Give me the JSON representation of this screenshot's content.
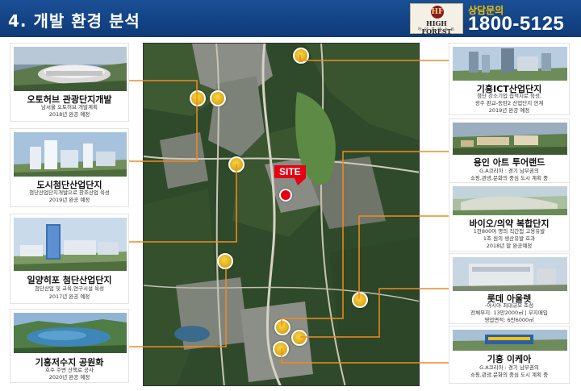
{
  "header": {
    "title": "4. 개발 환경 분석",
    "phone_label": "상담문의",
    "phone_number": "1800-5125",
    "logo_emblem": "HF",
    "logo_name": "HIGH FOREST",
    "logo_sub": "하 이 포 레 스 트"
  },
  "map": {
    "site_label": "SITE"
  },
  "left_cards": [
    {
      "title": "오토허브 관광단지개발",
      "desc": [
        "남서울 오토허브 개발계획",
        "2018년 완공 예정"
      ]
    },
    {
      "title": "도시첨단산업단지",
      "desc": [
        "첨단산업단지개발으로 창조산업 육성",
        "2019년 완공 예정"
      ]
    },
    {
      "title": "일양히포 첨단산업단지",
      "desc": [
        "첨단산업 및 교육,연구시설 육성",
        "2017년 완공 예정"
      ]
    },
    {
      "title": "기흥저수지 공원화",
      "desc": [
        "호수 주변 산책로 공사",
        "2020년 완공 예정"
      ]
    }
  ],
  "right_cards": [
    {
      "title": "기흥ICT산업단지",
      "desc": [
        "첨단 강소기업 집적지로 육성,",
        "광주 판교-동탄2 산업단지 연계",
        "2019년 완공 예정"
      ]
    },
    {
      "title": "용인 아트 투어랜드",
      "desc": [
        "G.A코리아 : 경기 남부권의",
        "쇼핑,관광,문화의 중심 도시 계획 중"
      ]
    },
    {
      "title": "바이오/의약 복합단지",
      "desc": [
        "1천800여 명의 직간접 고용유발",
        "1조 원의 생산유발 효과",
        "2018년 말 완공예정"
      ]
    },
    {
      "title": "롯데 아울렛",
      "desc": [
        "-아시아 최대규모 조성",
        "전체부지: 13만2000㎡ | 부지매입",
        "영업면적: 6만6000㎡"
      ]
    },
    {
      "title": "기흥 이케아",
      "desc": [
        "G.A코리아 : 경기 남부권의",
        "쇼핑,관광,문화의 중심 도시 계획 중"
      ]
    }
  ],
  "colors": {
    "header_bg": "#1a4f96",
    "phone_number": "#ffffff",
    "phone_label": "#f5c400",
    "connector_line": "#f08c1e",
    "site_red": "#e60012",
    "marker_gold": "#e2b21e"
  }
}
